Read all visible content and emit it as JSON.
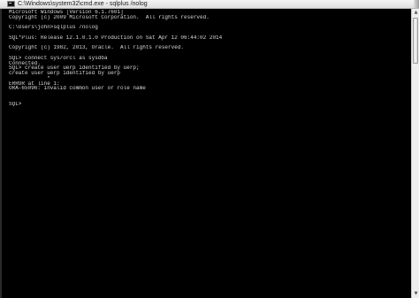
{
  "window": {
    "title": "C:\\Windows\\system32\\cmd.exe - sqlplus  /nolog"
  },
  "console": {
    "lines": [
      "Microsoft Windows [Version 6.1.7601]",
      "Copyright (c) 2009 Microsoft Corporation.  All rights reserved.",
      "",
      "C:\\Users\\john>sqlplus /nolog",
      "",
      "SQL*Plus: Release 12.1.0.1.0 Production on Sat Apr 12 06:44:02 2014",
      "",
      "Copyright (c) 1982, 2013, Oracle.  All rights reserved.",
      "",
      "SQL> connect sys/orcl as sysdba",
      "Connected.",
      "SQL> create user uerp identified by uerp;",
      "create user uerp identified by uerp",
      "            *",
      "ERROR at line 1:",
      "ORA-65096: invalid common user or role name",
      "",
      "",
      "SQL> "
    ]
  },
  "icons": {
    "window_icon": "cmd-console-icon",
    "scroll_up": "arrow-up-icon",
    "scroll_down": "arrow-down-icon"
  }
}
